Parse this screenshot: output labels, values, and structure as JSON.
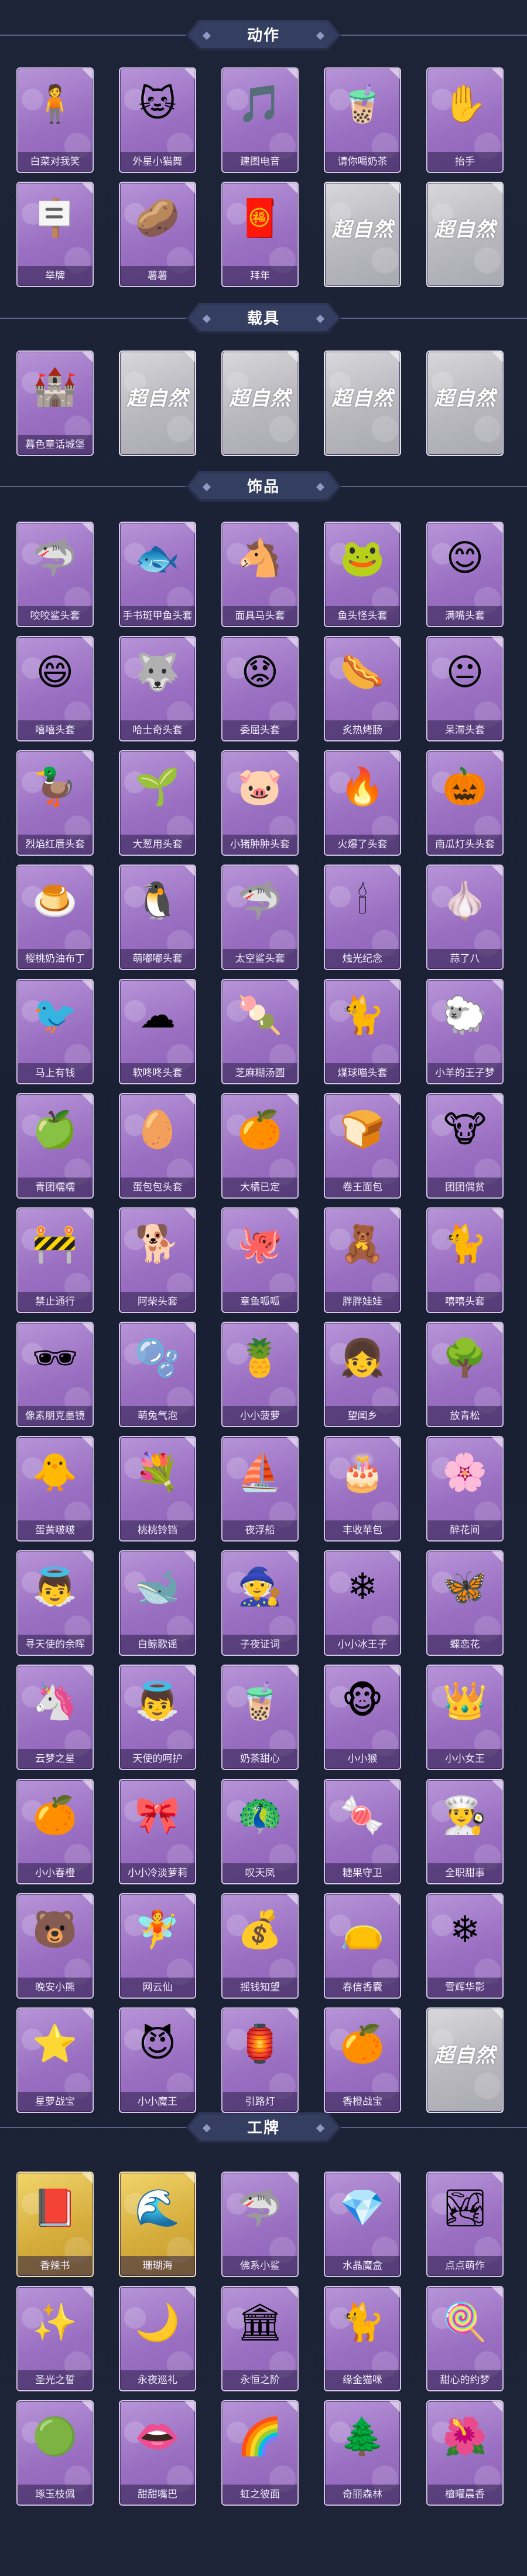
{
  "sections": {
    "actions": {
      "title": "动作"
    },
    "vehicles": {
      "title": "载具"
    },
    "accessories": {
      "title": "饰品"
    },
    "badges": {
      "title": "工牌"
    }
  },
  "locked_text": "超自然",
  "colors": {
    "background": "#1c2236",
    "card_purple": "#9a6fc2",
    "card_gold": "#d6ae3e",
    "card_locked": "#b8b8be"
  },
  "actions": [
    {
      "label": "白菜对我笑",
      "icon": "person-pose-icon"
    },
    {
      "label": "外星小猫舞",
      "icon": "dancing-cat-icon"
    },
    {
      "label": "建图电音",
      "icon": "music-dance-icon"
    },
    {
      "label": "请你喝奶茶",
      "icon": "milk-tea-icon"
    },
    {
      "label": "抬手",
      "icon": "raise-hand-icon"
    },
    {
      "label": "举牌",
      "icon": "hold-sign-icon"
    },
    {
      "label": "薯薯",
      "icon": "potato-pose-icon"
    },
    {
      "label": "拜年",
      "icon": "new-year-bow-icon"
    }
  ],
  "vehicles": [
    {
      "label": "暮色童话城堡",
      "icon": "castle-icon"
    }
  ],
  "accessories": [
    {
      "label": "咬咬鲨头套",
      "icon": "shark-icon"
    },
    {
      "label": "手书斑甲鱼头套",
      "icon": "fish-head-icon"
    },
    {
      "label": "面具马头套",
      "icon": "horse-head-icon"
    },
    {
      "label": "鱼头怪头套",
      "icon": "fish-monster-icon"
    },
    {
      "label": "满嘴头套",
      "icon": "smile-face-icon"
    },
    {
      "label": "嘻嘻头套",
      "icon": "grin-face-icon"
    },
    {
      "label": "哈士奇头套",
      "icon": "husky-icon"
    },
    {
      "label": "委屈头套",
      "icon": "sad-face-icon"
    },
    {
      "label": "炙热烤肠",
      "icon": "sausage-icon"
    },
    {
      "label": "呆滞头套",
      "icon": "dull-face-icon"
    },
    {
      "label": "烈焰红唇头套",
      "icon": "duck-lips-icon"
    },
    {
      "label": "大葱用头套",
      "icon": "green-onion-icon"
    },
    {
      "label": "小猪肿肿头套",
      "icon": "pig-icon"
    },
    {
      "label": "火爆了头套",
      "icon": "fire-icon"
    },
    {
      "label": "南瓜灯头头套",
      "icon": "pumpkin-icon"
    },
    {
      "label": "樱桃奶油布丁",
      "icon": "pudding-icon"
    },
    {
      "label": "萌嘟嘟头套",
      "icon": "penguin-icon"
    },
    {
      "label": "太空鲨头套",
      "icon": "space-shark-icon"
    },
    {
      "label": "烛光纪念",
      "icon": "candle-icon"
    },
    {
      "label": "蒜了八",
      "icon": "garlic-icon"
    },
    {
      "label": "马上有钱",
      "icon": "red-bird-icon"
    },
    {
      "label": "软咚咚头套",
      "icon": "cloud-icon"
    },
    {
      "label": "芝麻糊汤圆",
      "icon": "dumpling-icon"
    },
    {
      "label": "煤球喵头套",
      "icon": "black-cat-icon"
    },
    {
      "label": "小羊的王子梦",
      "icon": "sheep-icon"
    },
    {
      "label": "青团糯糯",
      "icon": "green-bun-icon"
    },
    {
      "label": "蛋包包头套",
      "icon": "egg-icon"
    },
    {
      "label": "大橘已定",
      "icon": "orange-icon"
    },
    {
      "label": "卷王面包",
      "icon": "bread-roll-icon"
    },
    {
      "label": "团团偶贫",
      "icon": "cow-icon"
    },
    {
      "label": "禁止通行",
      "icon": "barrier-icon"
    },
    {
      "label": "阿柴头套",
      "icon": "shiba-icon"
    },
    {
      "label": "章鱼呱呱",
      "icon": "octopus-icon"
    },
    {
      "label": "胖胖娃娃",
      "icon": "doll-icon"
    },
    {
      "label": "嘻嘻头套",
      "icon": "tabby-cat-icon"
    },
    {
      "label": "像素朋克墨镜",
      "icon": "pixel-glasses-icon"
    },
    {
      "label": "萌兔气泡",
      "icon": "bubble-icon"
    },
    {
      "label": "小小菠萝",
      "icon": "pineapple-icon"
    },
    {
      "label": "望闻乡",
      "icon": "girl-icon"
    },
    {
      "label": "放青松",
      "icon": "bonsai-icon"
    },
    {
      "label": "蛋黄啵啵",
      "icon": "chick-icon"
    },
    {
      "label": "桃桃铃铛",
      "icon": "wreath-icon"
    },
    {
      "label": "夜浮船",
      "icon": "glass-boat-icon"
    },
    {
      "label": "丰收苹包",
      "icon": "cake-icon"
    },
    {
      "label": "醉花间",
      "icon": "hairpin-icon"
    },
    {
      "label": "寻天使的余晖",
      "icon": "angel-doll-icon"
    },
    {
      "label": "白鲸歌谣",
      "icon": "beluga-icon"
    },
    {
      "label": "子夜证词",
      "icon": "witch-doll-icon"
    },
    {
      "label": "小小冰王子",
      "icon": "ice-prince-icon"
    },
    {
      "label": "蝶恋花",
      "icon": "butterfly-icon"
    },
    {
      "label": "云梦之星",
      "icon": "unicorn-icon"
    },
    {
      "label": "天使的呵护",
      "icon": "angel-icon"
    },
    {
      "label": "奶茶甜心",
      "icon": "milk-tea-doll-icon"
    },
    {
      "label": "小小猴",
      "icon": "monkey-icon"
    },
    {
      "label": "小小女王",
      "icon": "queen-doll-icon"
    },
    {
      "label": "小小春橙",
      "icon": "orange-monster-icon"
    },
    {
      "label": "小小冷淡萝莉",
      "icon": "gothic-doll-icon"
    },
    {
      "label": "叹天凤",
      "icon": "phoenix-doll-icon"
    },
    {
      "label": "糖果守卫",
      "icon": "candy-guard-icon"
    },
    {
      "label": "全职甜事",
      "icon": "chef-doll-icon"
    },
    {
      "label": "晚安小熊",
      "icon": "bear-charm-icon"
    },
    {
      "label": "网云仙",
      "icon": "fairy-charm-icon"
    },
    {
      "label": "摇钱知望",
      "icon": "money-charm-icon"
    },
    {
      "label": "春信香囊",
      "icon": "sachet-icon"
    },
    {
      "label": "雪辉华影",
      "icon": "snow-charm-icon"
    },
    {
      "label": "星萝战宝",
      "icon": "star-monster-icon"
    },
    {
      "label": "小小魔王",
      "icon": "demon-doll-icon"
    },
    {
      "label": "引路灯",
      "icon": "lantern-icon"
    },
    {
      "label": "香橙战宝",
      "icon": "orange-charm-icon"
    }
  ],
  "badges": [
    {
      "label": "香辣书",
      "icon": "spellbook-card-icon",
      "gold": true
    },
    {
      "label": "珊瑚海",
      "icon": "ocean-card-icon",
      "gold": true
    },
    {
      "label": "佛系小鲨",
      "icon": "shark-card-icon",
      "gold": false
    },
    {
      "label": "水晶魔盒",
      "icon": "crystal-card-icon",
      "gold": false
    },
    {
      "label": "点点萌作",
      "icon": "landscape-card-icon",
      "gold": false
    },
    {
      "label": "圣光之誓",
      "icon": "holy-card-icon",
      "gold": false
    },
    {
      "label": "永夜巡礼",
      "icon": "night-card-icon",
      "gold": false
    },
    {
      "label": "永恒之阶",
      "icon": "stairs-card-icon",
      "gold": false
    },
    {
      "label": "缘金猫咪",
      "icon": "gold-cat-card-icon",
      "gold": false
    },
    {
      "label": "甜心的约梦",
      "icon": "sweet-card-icon",
      "gold": false
    },
    {
      "label": "琢玉枝佩",
      "icon": "jade-card-icon",
      "gold": false
    },
    {
      "label": "甜甜嘴巴",
      "icon": "mouth-card-icon",
      "gold": false
    },
    {
      "label": "虹之彼面",
      "icon": "rainbow-card-icon",
      "gold": false
    },
    {
      "label": "奇丽森林",
      "icon": "forest-card-icon",
      "gold": false
    },
    {
      "label": "檀曜晨香",
      "icon": "incense-card-icon",
      "gold": false
    }
  ]
}
